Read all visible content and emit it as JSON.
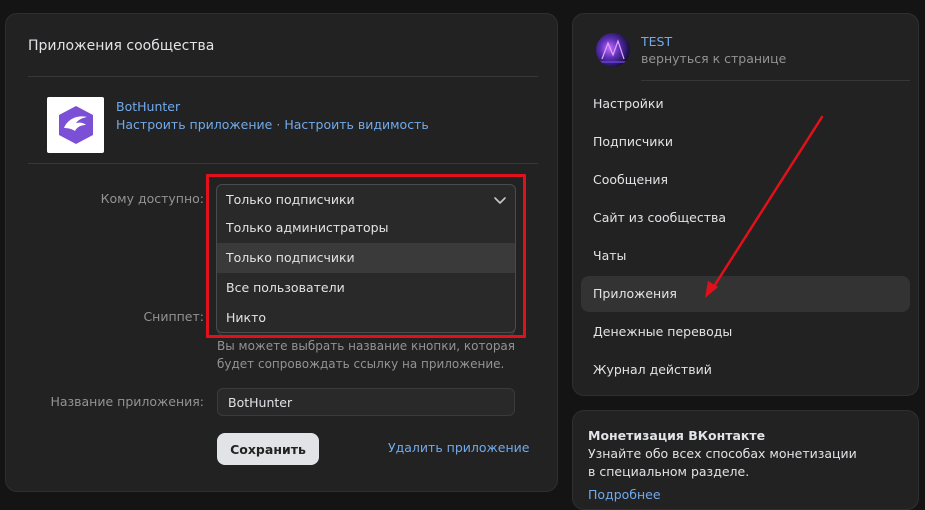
{
  "main": {
    "title": "Приложения сообщества",
    "app": {
      "name": "BotHunter",
      "configure_app": "Настроить приложение",
      "separator": "·",
      "configure_visibility": "Настроить видимость"
    },
    "access": {
      "label": "Кому доступно:",
      "selected": "Только подписчики",
      "options": [
        "Только администраторы",
        "Только подписчики",
        "Все пользователи",
        "Никто"
      ]
    },
    "snippet": {
      "label": "Сниппет:",
      "hint": "Вы можете выбрать название кнопки, которая будет сопровождать ссылку на приложение."
    },
    "app_name_field": {
      "label": "Название приложения:",
      "value": "BotHunter"
    },
    "save_label": "Сохранить",
    "delete_label": "Удалить приложение"
  },
  "nav": {
    "community_name": "TEST",
    "back_label": "вернуться к странице",
    "items": [
      {
        "label": "Настройки"
      },
      {
        "label": "Подписчики"
      },
      {
        "label": "Сообщения"
      },
      {
        "label": "Сайт из сообщества"
      },
      {
        "label": "Чаты"
      },
      {
        "label": "Приложения",
        "active": true
      },
      {
        "label": "Денежные переводы"
      },
      {
        "label": "Журнал действий"
      }
    ]
  },
  "monetization": {
    "title": "Монетизация ВКонтакте",
    "text": "Узнайте обо всех способах монетизации в специальном разделе.",
    "link": "Подробнее"
  },
  "colors": {
    "accent_link": "#71aaeb",
    "highlight_red": "#e0111b",
    "background": "#141414",
    "card": "#222222"
  }
}
